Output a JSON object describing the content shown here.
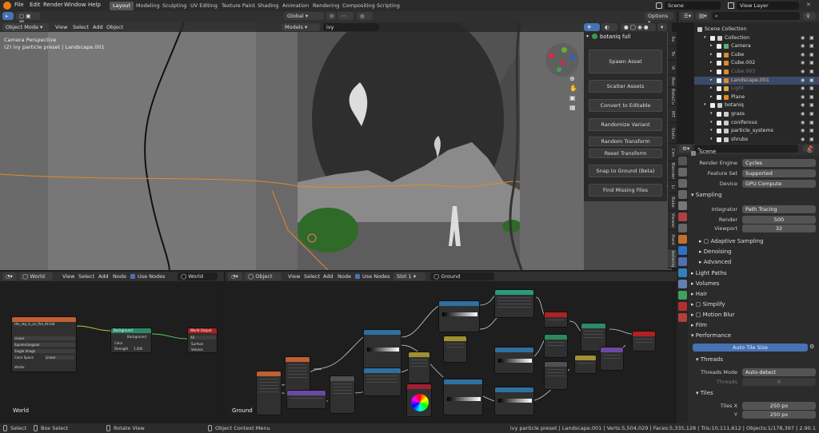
{
  "menu": [
    "File",
    "Edit",
    "Render",
    "Window",
    "Help"
  ],
  "workspaces": [
    "Layout",
    "Modeling",
    "Sculpting",
    "UV Editing",
    "Texture Paint",
    "Shading",
    "Animation",
    "Rendering",
    "Compositing",
    "Scripting"
  ],
  "active_workspace": "Layout",
  "scene_field": "Scene",
  "view_layer_field": "View Layer",
  "viewport_header": {
    "mode": "Object Mode",
    "menus": [
      "View",
      "Select",
      "Add",
      "Object"
    ],
    "transform_orientation": "Global",
    "options": "Options",
    "collection_filter": "Models",
    "search_text": "ivy"
  },
  "viewport_overlay": {
    "line1": "Camera Perspective",
    "line2": "(2) ivy particle preset | Landscape.001"
  },
  "addon_panel": {
    "title": "botaniq full",
    "buttons": [
      "Spawn Asset",
      "Scatter Assets",
      "Convert to Editable",
      "Randomize Variant",
      "Random Transform",
      "Reset Transform",
      "Snap to Ground (Beta)",
      "Find Missing Files"
    ]
  },
  "sidebar_tabs": [
    "Ite",
    "To",
    "Vi",
    "Ren",
    "BotaCu",
    "MT",
    "Stats",
    "Cim",
    "Blender",
    "Li",
    "Bake",
    "Viewer",
    "Hard",
    "botaniq"
  ],
  "outliner": {
    "search_placeholder": "",
    "rows": [
      {
        "label": "Scene Collection",
        "indent": 0,
        "kind": "root"
      },
      {
        "label": "Collection",
        "indent": 1,
        "kind": "collection"
      },
      {
        "label": "Camera",
        "indent": 2,
        "kind": "object"
      },
      {
        "label": "Cube",
        "indent": 2,
        "kind": "object"
      },
      {
        "label": "Cube.002",
        "indent": 2,
        "kind": "object"
      },
      {
        "label": "Cube.003",
        "indent": 2,
        "kind": "object",
        "dim": true
      },
      {
        "label": "Landscape.001",
        "indent": 2,
        "kind": "object",
        "selected": true
      },
      {
        "label": "Light",
        "indent": 2,
        "kind": "object",
        "dim": true
      },
      {
        "label": "Plane",
        "indent": 2,
        "kind": "object"
      },
      {
        "label": "botaniq",
        "indent": 1,
        "kind": "collection"
      },
      {
        "label": "grass",
        "indent": 2,
        "kind": "collection"
      },
      {
        "label": "coniferous",
        "indent": 2,
        "kind": "collection"
      },
      {
        "label": "particle_systems",
        "indent": 2,
        "kind": "collection"
      },
      {
        "label": "shrubs",
        "indent": 2,
        "kind": "collection"
      }
    ]
  },
  "properties": {
    "context": "Scene",
    "render_engine_label": "Render Engine",
    "render_engine": "Cycles",
    "feature_set_label": "Feature Set",
    "feature_set": "Supported",
    "device_label": "Device",
    "device": "GPU Compute",
    "sampling_label": "Sampling",
    "integrator_label": "Integrator",
    "integrator": "Path Tracing",
    "render_label": "Render",
    "render_samples": "500",
    "viewport_label": "Viewport",
    "viewport_samples": "32",
    "subsections": [
      "Adaptive Sampling",
      "Denoising",
      "Advanced"
    ],
    "sections": [
      "Light Paths",
      "Volumes",
      "Hair",
      "Simplify",
      "Motion Blur",
      "Film",
      "Performance"
    ],
    "auto_tile": "Auto Tile Size",
    "threads_label": "Threads",
    "threads_mode_label": "Threads Mode",
    "threads_mode": "Auto-detect",
    "threads_count_label": "Threads",
    "threads_count": "8",
    "tiles_label": "Tiles",
    "tiles_x_label": "Tiles X",
    "tiles_x": "250 px",
    "tiles_y_label": "Y",
    "tiles_y": "250 px"
  },
  "world_editor": {
    "type": "World",
    "menus": [
      "View",
      "Select",
      "Add",
      "Node"
    ],
    "use_nodes": "Use Nodes",
    "datablock": "World",
    "corner_label": "World",
    "env_node_title": "the_sky_is_on_fire_4k.hdr",
    "env_node_rows": [
      "Linear",
      "Equirectangular",
      "Single Image",
      "Color Space",
      "Vector"
    ],
    "env_color_space": "Linear",
    "bg_node_title": "Background",
    "bg_rows": [
      "Background",
      "Color",
      "Strength"
    ],
    "bg_strength": "1.000",
    "out_node_title": "World Output",
    "out_rows": [
      "All",
      "Surface",
      "Volume"
    ]
  },
  "object_editor": {
    "type": "Object",
    "menus": [
      "View",
      "Select",
      "Add",
      "Node"
    ],
    "use_nodes": "Use Nodes",
    "slot": "Slot 1",
    "material": "Ground",
    "corner_label": "Ground"
  },
  "statusbar": {
    "select": "Select",
    "box_select": "Box Select",
    "rotate_view": "Rotate View",
    "context_menu": "Object Context Menu",
    "stats": "ivy particle preset | Landscape.001 | Verts:5,504,029 | Faces:5,335,128 | Tris:10,111,612 | Objects:1/178,397 | 2.90.1"
  },
  "colors": {
    "header_orange": "#c06030",
    "header_red": "#b02020",
    "header_green": "#2a8a6a",
    "header_blue": "#3070a0",
    "header_purple": "#6a4aa0",
    "header_yellow": "#a09030",
    "selection_blue": "#4772b3",
    "accent_orange": "#e08a2a"
  }
}
